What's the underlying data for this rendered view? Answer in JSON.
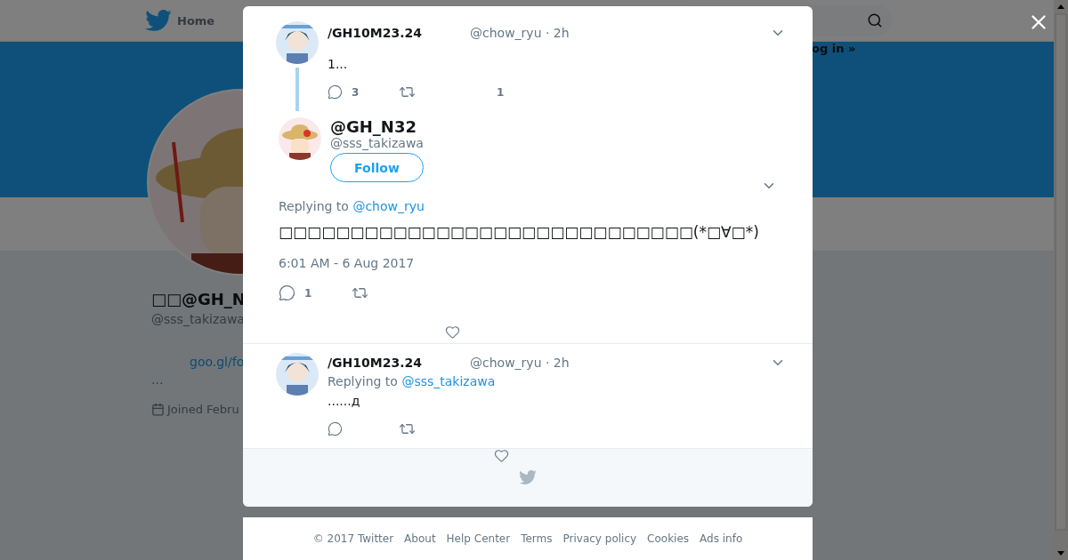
{
  "background": {
    "nav_home": "Home",
    "login": "og in »",
    "profile_name": "□□@GH_N",
    "profile_handle": "@sss_takizawa",
    "profile_link": "goo.gl/fo",
    "profile_more": "...",
    "joined": "Joined Febru"
  },
  "ancestor": {
    "name": "/GH10M23.24",
    "handle": "@chow_ryu · 2h",
    "text": "1...",
    "reply_count": "3",
    "like_count": "1"
  },
  "focused": {
    "name": "@GH_N32",
    "handle": "@sss_takizawa",
    "follow": "Follow",
    "replying_label": "Replying to",
    "replying_to": "@chow_ryu",
    "text": "□□□□□□□□□□□□□□□□□□□□□□□□□□□□□(*□∀□*)",
    "time": "6:01 AM - 6 Aug 2017",
    "reply_count": "1"
  },
  "reply": {
    "name": "/GH10M23.24",
    "handle": "@chow_ryu · 2h",
    "replying_label": "Replying to",
    "replying_to": "@sss_takizawa",
    "text": "......д"
  },
  "footer": [
    "© 2017 Twitter",
    "About",
    "Help Center",
    "Terms",
    "Privacy policy",
    "Cookies",
    "Ads info"
  ]
}
